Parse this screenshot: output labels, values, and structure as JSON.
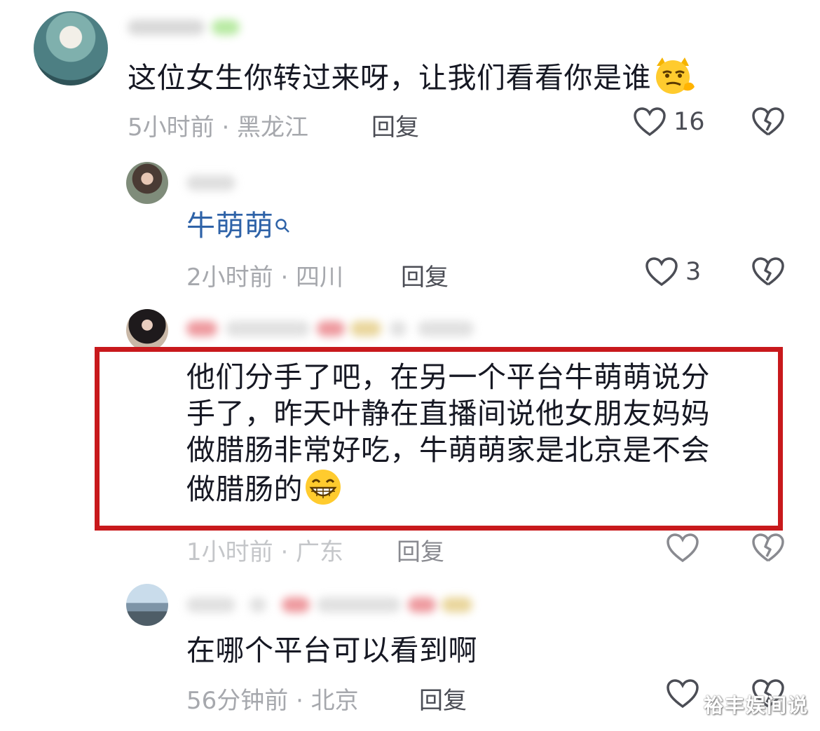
{
  "comments": [
    {
      "text": "这位女生你转过来呀，让我们看看你是谁",
      "meta": "5小时前 · 黑龙江",
      "reply_label": "回复",
      "like_count": "16"
    },
    {
      "text": "牛萌萌",
      "meta": "2小时前 · 四川",
      "reply_label": "回复",
      "like_count": "3"
    },
    {
      "text_lines": [
        "他们分手了吧，在另一个平台牛萌萌说分",
        "手了，昨天叶静在直播间说他女朋友妈妈",
        "做腊肠非常好吃，牛萌萌家是北京是不会",
        "做腊肠的"
      ],
      "meta": "1小时前 · 广东",
      "reply_label": "回复"
    },
    {
      "text": "在哪个平台可以看到啊",
      "meta": "56分钟前 · 北京",
      "reply_label": "回复"
    }
  ],
  "icons": {
    "like": "heart-outline-icon",
    "dislike": "broken-heart-icon",
    "search": "search-icon",
    "emoji_smirk": "smirk-cat-emoji",
    "emoji_grin": "grin-emoji"
  },
  "colors": {
    "text": "#161823",
    "meta": "#a6a8ad",
    "link": "#2f63a8",
    "highlight": "#c8191c"
  },
  "watermark": "裕丰娱间说"
}
